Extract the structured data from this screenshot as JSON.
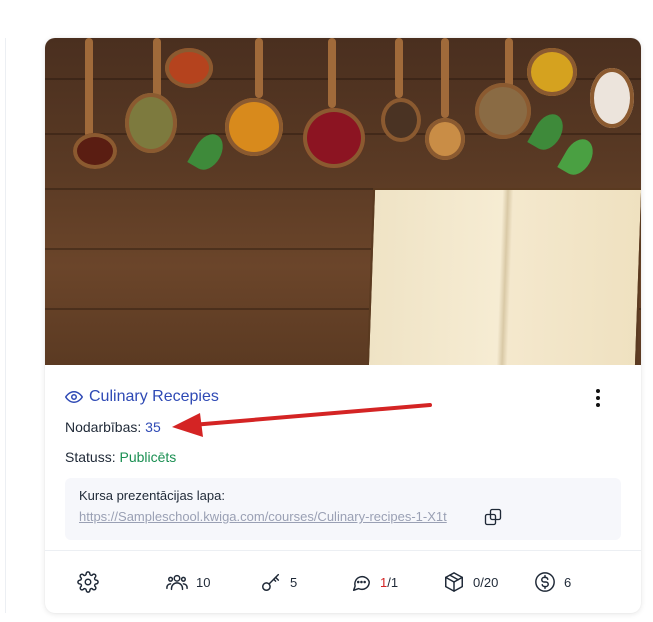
{
  "course": {
    "title": "Culinary Recepies",
    "lessons_label": "Nodarbības:",
    "lessons_count": "35",
    "status_label": "Statuss:",
    "status_value": "Publicēts",
    "presentation_label": "Kursa prezentācijas lapa:",
    "presentation_url": "https://Sampleschool.kwiga.com/courses/Culinary-recipes-1-X1t"
  },
  "footer": {
    "students": "10",
    "keys": "5",
    "comments_new": "1",
    "comments_total": "/1",
    "modules": "0/20",
    "price": "6"
  },
  "colors": {
    "link": "#2f4ab5",
    "status": "#1a8f52",
    "annotation_arrow": "#d42424"
  },
  "icons": [
    "eye-icon",
    "more-vertical-icon",
    "copy-icon",
    "settings-icon",
    "users-icon",
    "key-icon",
    "comment-icon",
    "cube-icon",
    "dollar-icon"
  ]
}
